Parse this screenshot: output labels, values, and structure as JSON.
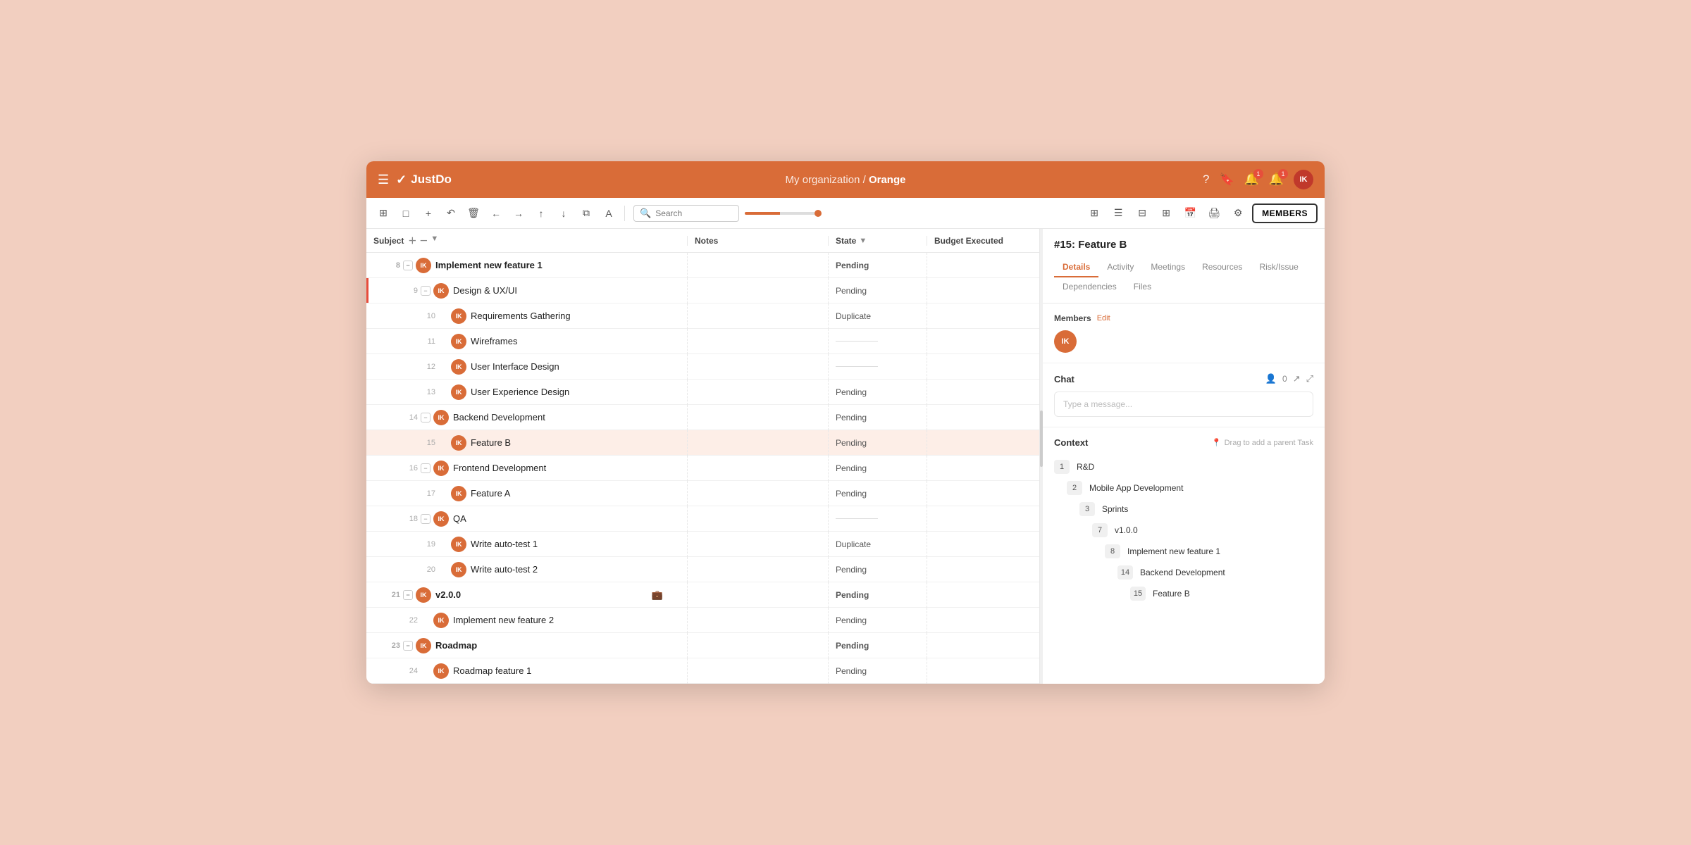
{
  "header": {
    "hamburger": "☰",
    "logo_check": "✓",
    "logo_text": "JustDo",
    "org_name": "My organization",
    "separator": "/",
    "project_name": "Orange",
    "icons": {
      "help": "?",
      "bookmark": "🔖",
      "notifications1": "🔔",
      "notifications2": "🔔",
      "avatar": "IK"
    },
    "badge1": "1",
    "badge2": "1"
  },
  "toolbar": {
    "search_placeholder": "Search",
    "members_label": "MEMBERS",
    "icons": [
      "⊞",
      "□",
      "⊟",
      "□□",
      "⊞□",
      "🖨",
      "⚙"
    ]
  },
  "columns": {
    "subject": "Subject",
    "notes": "Notes",
    "state": "State",
    "budget": "Budget Executed"
  },
  "tasks": [
    {
      "id": 8,
      "level": 0,
      "collapse": true,
      "name": "Implement new feature 1",
      "state": "Pending",
      "has_red_bar": false,
      "avatar": "IK"
    },
    {
      "id": 9,
      "level": 1,
      "collapse": true,
      "name": "Design & UX/UI",
      "state": "Pending",
      "has_red_bar": true,
      "avatar": "IK"
    },
    {
      "id": 10,
      "level": 2,
      "collapse": false,
      "name": "Requirements Gathering",
      "state": "Duplicate",
      "has_red_bar": false,
      "avatar": "IK"
    },
    {
      "id": 11,
      "level": 2,
      "collapse": false,
      "name": "Wireframes",
      "state": "",
      "has_red_bar": false,
      "avatar": "IK"
    },
    {
      "id": 12,
      "level": 2,
      "collapse": false,
      "name": "User Interface Design",
      "state": "",
      "has_red_bar": false,
      "avatar": "IK"
    },
    {
      "id": 13,
      "level": 2,
      "collapse": false,
      "name": "User Experience Design",
      "state": "Pending",
      "has_red_bar": false,
      "avatar": "IK"
    },
    {
      "id": 14,
      "level": 1,
      "collapse": true,
      "name": "Backend Development",
      "state": "Pending",
      "has_red_bar": false,
      "avatar": "IK"
    },
    {
      "id": 15,
      "level": 2,
      "collapse": false,
      "name": "Feature B",
      "state": "Pending",
      "has_red_bar": false,
      "avatar": "IK",
      "selected": true
    },
    {
      "id": 16,
      "level": 1,
      "collapse": true,
      "name": "Frontend Development",
      "state": "Pending",
      "has_red_bar": false,
      "avatar": "IK"
    },
    {
      "id": 17,
      "level": 2,
      "collapse": false,
      "name": "Feature A",
      "state": "Pending",
      "has_red_bar": false,
      "avatar": "IK"
    },
    {
      "id": 18,
      "level": 1,
      "collapse": true,
      "name": "QA",
      "state": "",
      "has_red_bar": false,
      "avatar": "IK"
    },
    {
      "id": 19,
      "level": 2,
      "collapse": false,
      "name": "Write auto-test 1",
      "state": "Duplicate",
      "has_red_bar": false,
      "avatar": "IK"
    },
    {
      "id": 20,
      "level": 2,
      "collapse": false,
      "name": "Write auto-test 2",
      "state": "Pending",
      "has_red_bar": false,
      "avatar": "IK"
    },
    {
      "id": 21,
      "level": 0,
      "collapse": true,
      "name": "v2.0.0",
      "state": "Pending",
      "has_red_bar": false,
      "avatar": "IK",
      "has_bag": true
    },
    {
      "id": 22,
      "level": 1,
      "collapse": false,
      "name": "Implement new feature 2",
      "state": "Pending",
      "has_red_bar": false,
      "avatar": "IK"
    },
    {
      "id": 23,
      "level": 0,
      "collapse": true,
      "name": "Roadmap",
      "state": "Pending",
      "has_red_bar": false,
      "avatar": "IK"
    },
    {
      "id": 24,
      "level": 1,
      "collapse": false,
      "name": "Roadmap feature 1",
      "state": "Pending",
      "has_red_bar": false,
      "avatar": "IK"
    }
  ],
  "detail": {
    "title": "#15:  Feature B",
    "tabs": [
      "Details",
      "Activity",
      "Meetings",
      "Resources",
      "Risk/Issue",
      "Dependencies",
      "Files"
    ],
    "active_tab": "Details",
    "members_label": "Members",
    "members_edit": "Edit",
    "member_avatar": "IK",
    "chat_label": "Chat",
    "chat_count": "0",
    "chat_placeholder": "Type a message...",
    "context_label": "Context",
    "drag_hint": "Drag to add a parent Task",
    "context_items": [
      {
        "num": 1,
        "label": "R&D",
        "indent": 0
      },
      {
        "num": 2,
        "label": "Mobile App Development",
        "indent": 1
      },
      {
        "num": 3,
        "label": "Sprints",
        "indent": 2
      },
      {
        "num": 7,
        "label": "v1.0.0",
        "indent": 3
      },
      {
        "num": 8,
        "label": "Implement new feature 1",
        "indent": 4
      },
      {
        "num": 14,
        "label": "Backend Development",
        "indent": 5
      },
      {
        "num": 15,
        "label": "Feature B",
        "indent": 6
      }
    ]
  }
}
